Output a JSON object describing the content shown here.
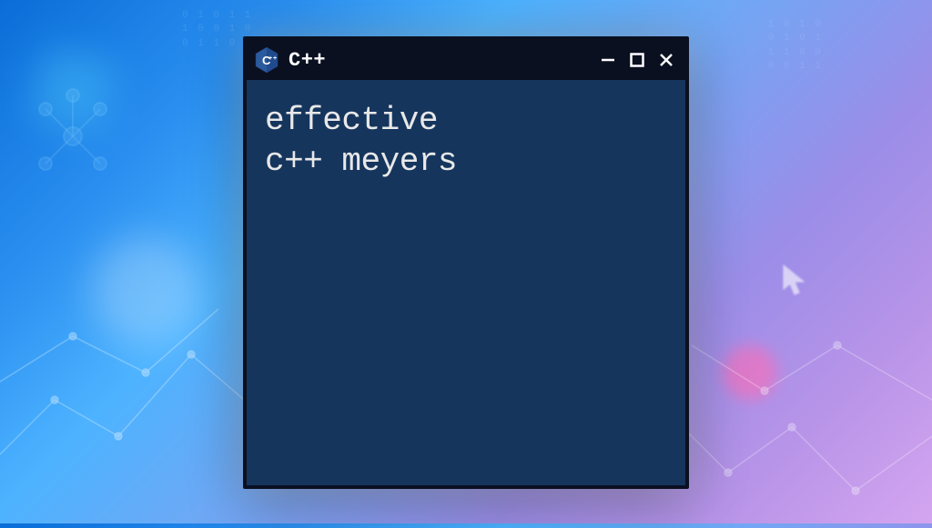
{
  "window": {
    "title": "C++",
    "icon_name": "cpp-hexagon-icon"
  },
  "terminal": {
    "content_line1": "effective",
    "content_line2": "c++ meyers"
  },
  "colors": {
    "titlebar_bg": "#0a1020",
    "terminal_bg": "#15355d",
    "terminal_fg": "#e8e8e8"
  }
}
